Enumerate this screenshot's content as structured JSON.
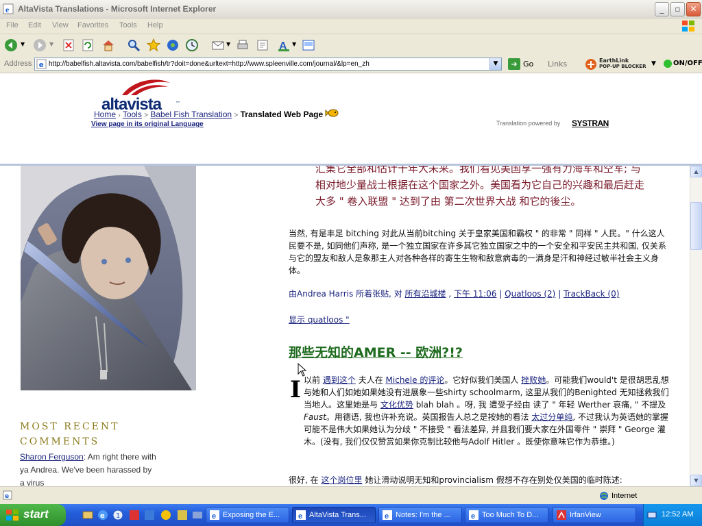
{
  "window": {
    "title": "AltaVista Translations - Microsoft Internet Explorer",
    "minimize": "_",
    "maximize": "▫",
    "close": "✕"
  },
  "menu": [
    "File",
    "Edit",
    "View",
    "Favorites",
    "Tools",
    "Help"
  ],
  "address": {
    "label": "Address",
    "url": "http://babelfish.altavista.com/babelfish/tr?doit=done&urltext=http://www.spleenville.com/journal/&lp=en_zh",
    "go": "Go",
    "links": "Links",
    "earthlink_line1": "EarthLink",
    "earthlink_line2": "POP-UP BLOCKER",
    "onoff": "ON/OFF"
  },
  "babelfish": {
    "logo": "altavista",
    "logo_tm": "™",
    "breadcrumb": {
      "home": "Home",
      "tools": "Tools",
      "babel": "Babel Fish Translation",
      "current": "Translated Web Page"
    },
    "view_original": "View page in its original Language",
    "powered_by": "Translation powered by",
    "systran": "SYSTRAN"
  },
  "content": {
    "quote": "汇集它全部和估计十年大未来。我们看见美国享一强有力海军和空军; 与相对地少量战士根据在这个国家之外。美国看为它自己的兴趣和最后赶走大多 \" 卷入联盟 \" 达到了由 第二次世界大战 和它的後尘。",
    "para1": "当然, 有是丰足 bitching 对此从当前bitching 关于皇家美国和霸权 \" 的非常 \" 同样 \" 人民。\" 什么这人民要不是, 如同他们声称, 是一个独立国家在许多其它独立国家之中的一个安全和平安民主共和国, 仅关系与它的盟友和敌人是象那主人对各种各样的寄生生物和敌意病毒的一满身是汗和神经过敏半社会主义身体。",
    "posted": {
      "prefix": "由Andrea Harris 所着张贴, 对",
      "cat": "所有沿城楼",
      "time": "下午 11:06",
      "quatloos": "Quatloos (2)",
      "trackback": "TrackBack (0)",
      "sep": "|"
    },
    "show_quatloos": "显示 quatloos \"",
    "heading": "那些无知的AMER -- 欧洲?!?",
    "dropcap": "I",
    "para2": {
      "t1": "以前",
      "l1": "遇到这个",
      "t2": "夫人在",
      "l2": "Michele 的评论",
      "t3": "。它好似我们美国人",
      "l3": "挫败她",
      "t4": "。可能我们would't 是很胡思乱想与她和人们如她如果她没有进展象一些shirty schoolmarm, 这里从我们的Benighted 无知拯救我们当地人。这里她是与",
      "l4": "文化优势",
      "t5": "blah blah 。呀, 我 遭受子经由 读了 \" 年轻 Werther 哀痛, \" 不提及",
      "i1": "Faust",
      "t6": "。用德语, 我也许补充说。英国报告人总之是按她的看法",
      "l5": "太过分单纯",
      "t7": ", 不过我认为英语她的掌握可能不是伟大如果她认为分歧 \" 不接受 \" 看法差异, 并且我们要大家在外国零件 \" 崇拜 \" George 灌木。(没有, 我们仅仅赞赏如果你克制比较他与Adolf Hitler 。既使你意味它作为恭维。)"
    },
    "para3": {
      "t1": "很好, 在",
      "l1": "这个岗位里",
      "t2": "她让滑动说明无知和provincialism 假想不存在别处仅美国的临时陈述:"
    }
  },
  "sidebar": {
    "heading_line1": "MOST RECENT",
    "heading_line2": "COMMENTS",
    "comment_author": "Sharon Ferguson",
    "comment_text": ": Am right there with ya Andrea. We've been harassed by a virus"
  },
  "status": {
    "zone": "Internet"
  },
  "taskbar": {
    "start": "start",
    "tasks": [
      "Exposing the E...",
      "AltaVista Trans...",
      "Notes: I'm the ...",
      "Too Much To D...",
      "IrfanView"
    ],
    "clock": "12:52 AM"
  }
}
